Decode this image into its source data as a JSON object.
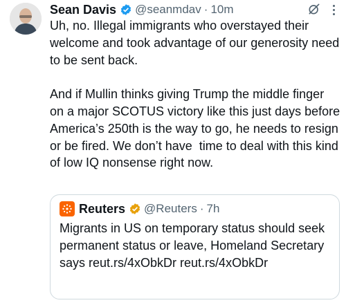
{
  "tweet": {
    "author_name": "Sean Davis",
    "author_handle": "@seanmdav",
    "separator": "·",
    "time": "10m",
    "verified_icon": "verified-badge-icon",
    "text": "Uh, no. Illegal immigrants who overstayed their welcome and took advantage of our generosity need to be sent back.\n\nAnd if Mullin thinks giving Trump the middle finger on a major SCOTUS victory like this just days before America’s 250th is the way to go, he needs to resign or be fired. We don’t have  time to deal with this kind of low IQ nonsense right now."
  },
  "quoted_tweet": {
    "author_name": "Reuters",
    "author_handle": "@Reuters",
    "separator": "·",
    "time": "7h",
    "verified_color": "#e8a10b",
    "logo_color": "#fa6400",
    "text": "Migrants in US on temporary status should seek permanent status or leave, Homeland Secretary says reut.rs/4xObkDr reut.rs/4xObkDr"
  },
  "colors": {
    "text": "#0f1419",
    "secondary": "#536471",
    "verified_blue": "#1d9bf0",
    "border": "#cfd9de"
  }
}
